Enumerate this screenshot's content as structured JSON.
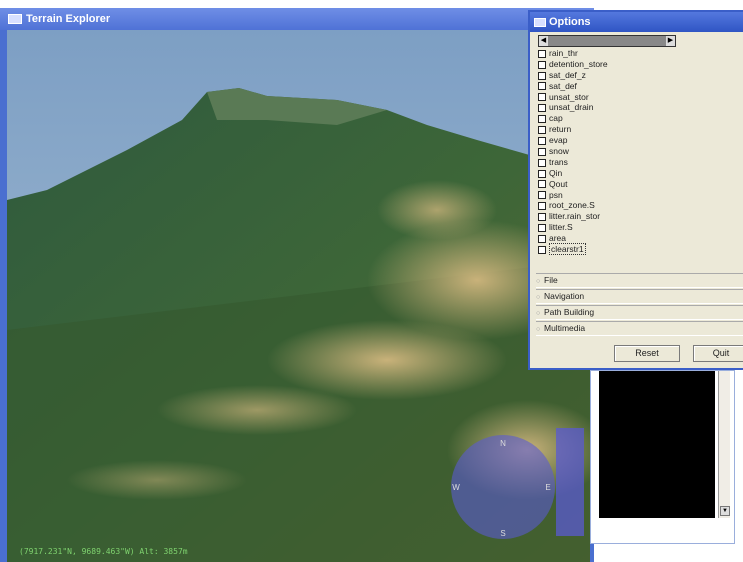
{
  "terrain_window": {
    "title": "Terrain Explorer",
    "status_coordinates": "(7917.231\"N, 9689.463\"W) Alt: 3857m",
    "compass": {
      "n": "N",
      "s": "S",
      "e": "E",
      "w": "W"
    }
  },
  "options_window": {
    "title": "Options",
    "variables": [
      "rain_thr",
      "detention_store",
      "sat_def_z",
      "sat_def",
      "unsat_stor",
      "unsat_drain",
      "cap",
      "return",
      "evap",
      "snow",
      "trans",
      "Qin",
      "Qout",
      "psn",
      "root_zone.S",
      "litter.rain_stor",
      "litter.S",
      "area",
      "clearstr1"
    ],
    "sections": [
      "File",
      "Navigation",
      "Path Building",
      "Multimedia"
    ],
    "buttons": {
      "reset": "Reset",
      "quit": "Quit"
    }
  },
  "colors": {
    "titlebar": "#4f72d6",
    "panel": "#ece9d8",
    "coord_text": "#7fd36f"
  }
}
